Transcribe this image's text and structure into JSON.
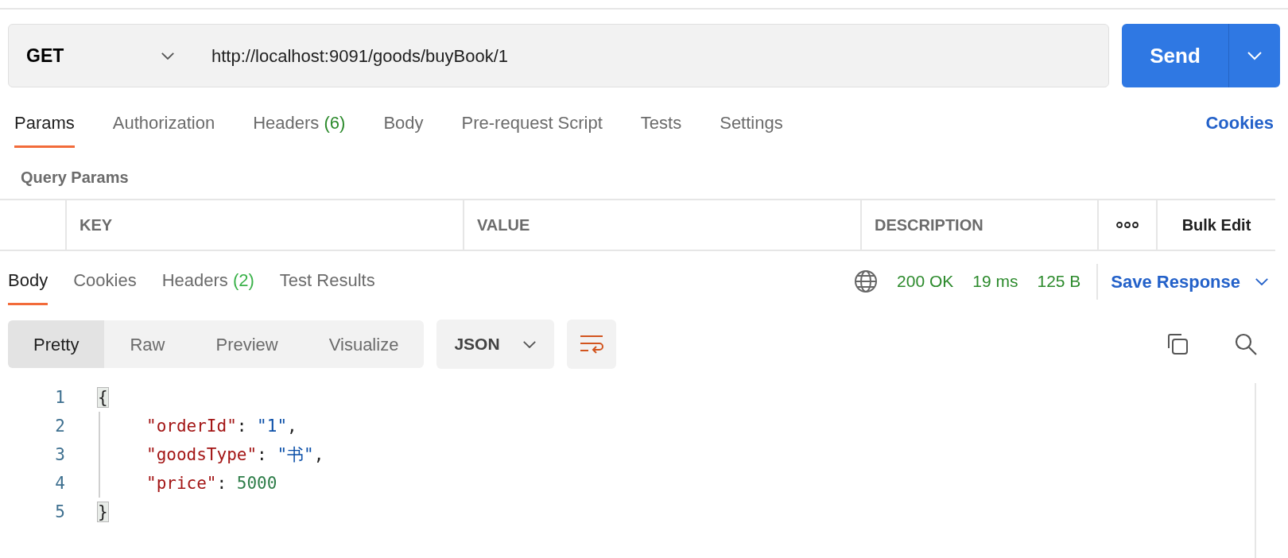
{
  "request": {
    "method": "GET",
    "url": "http://localhost:9091/goods/buyBook/1",
    "send_label": "Send"
  },
  "request_tabs": [
    {
      "label": "Params",
      "selected": true
    },
    {
      "label": "Authorization",
      "selected": false
    },
    {
      "label": "Headers",
      "count": "(6)",
      "selected": false
    },
    {
      "label": "Body",
      "selected": false
    },
    {
      "label": "Pre-request Script",
      "selected": false
    },
    {
      "label": "Tests",
      "selected": false
    },
    {
      "label": "Settings",
      "selected": false
    }
  ],
  "cookies_link": "Cookies",
  "query_params": {
    "title": "Query Params",
    "columns": [
      "KEY",
      "VALUE",
      "DESCRIPTION"
    ],
    "bulk_edit": "Bulk Edit"
  },
  "response_tabs": [
    {
      "label": "Body",
      "selected": true
    },
    {
      "label": "Cookies",
      "selected": false
    },
    {
      "label": "Headers",
      "count": "(2)",
      "selected": false
    },
    {
      "label": "Test Results",
      "selected": false
    }
  ],
  "response_status": {
    "status": "200 OK",
    "time": "19 ms",
    "size": "125 B"
  },
  "save_response": "Save Response",
  "format_tabs": [
    {
      "label": "Pretty",
      "selected": true
    },
    {
      "label": "Raw",
      "selected": false
    },
    {
      "label": "Preview",
      "selected": false
    },
    {
      "label": "Visualize",
      "selected": false
    }
  ],
  "format_select": "JSON",
  "code_lines": [
    {
      "number": "1",
      "tokens": [
        {
          "kind": "brace",
          "text": "{"
        }
      ]
    },
    {
      "number": "2",
      "tokens": [
        {
          "kind": "key",
          "text": "\"orderId\""
        },
        {
          "kind": "punct",
          "text": ": "
        },
        {
          "kind": "string",
          "text": "\"1\""
        },
        {
          "kind": "punct",
          "text": ","
        }
      ]
    },
    {
      "number": "3",
      "tokens": [
        {
          "kind": "key",
          "text": "\"goodsType\""
        },
        {
          "kind": "punct",
          "text": ": "
        },
        {
          "kind": "string",
          "text": "\"书\""
        },
        {
          "kind": "punct",
          "text": ","
        }
      ]
    },
    {
      "number": "4",
      "tokens": [
        {
          "kind": "key",
          "text": "\"price\""
        },
        {
          "kind": "punct",
          "text": ": "
        },
        {
          "kind": "number",
          "text": "5000"
        }
      ]
    },
    {
      "number": "5",
      "tokens": [
        {
          "kind": "brace",
          "text": "}"
        }
      ]
    }
  ]
}
